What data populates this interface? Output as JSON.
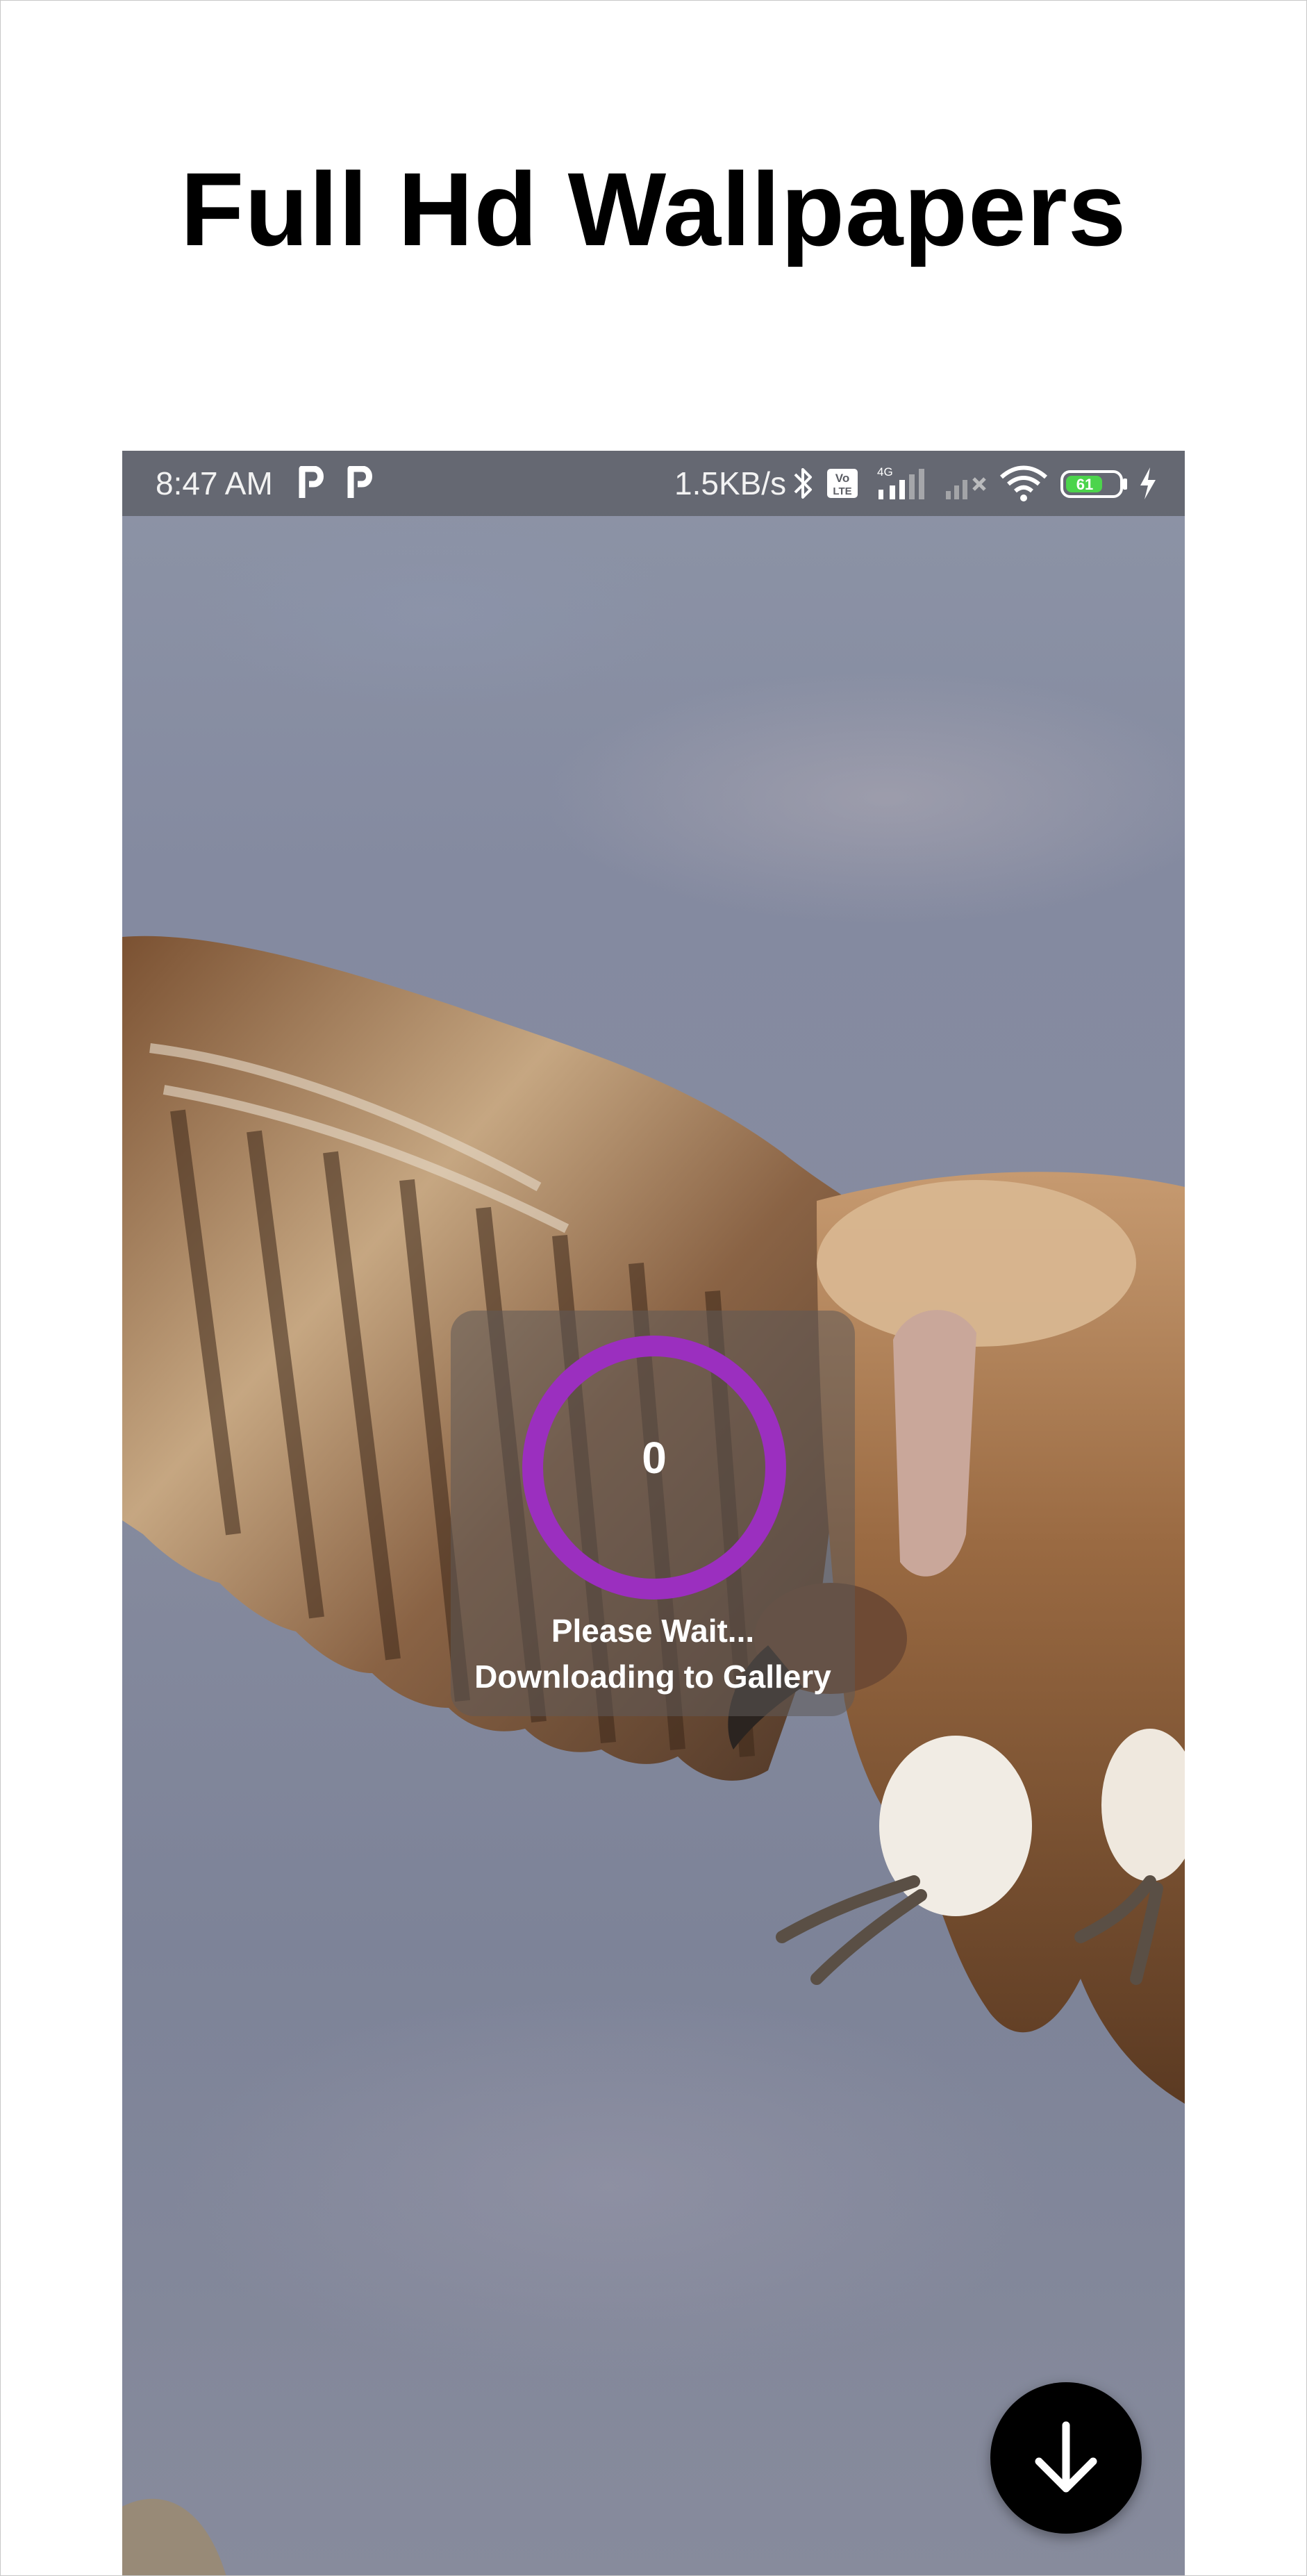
{
  "promo": {
    "title": "Full Hd Wallpapers"
  },
  "status_bar": {
    "time": "8:47 AM",
    "notification_icons": [
      "parking-p-icon",
      "parking-p-icon"
    ],
    "network_speed": "1.5KB/s",
    "network_type": "4G",
    "volte_badge": "Vo LTE",
    "battery_level": "61",
    "icons": [
      "bluetooth-icon",
      "volte-icon",
      "signal-4g-icon",
      "signal-no-service-icon",
      "wifi-icon",
      "battery-icon",
      "charging-icon"
    ]
  },
  "download_dialog": {
    "progress_value": "0",
    "progress_fraction": 0,
    "line1": "Please Wait...",
    "line2": "Downloading to Gallery",
    "ring_color": "#9b2fbf"
  },
  "fab": {
    "icon": "arrow-down-icon",
    "color": "#000000"
  },
  "wallpaper": {
    "subject": "vulture",
    "icon": "wallpaper-image"
  }
}
